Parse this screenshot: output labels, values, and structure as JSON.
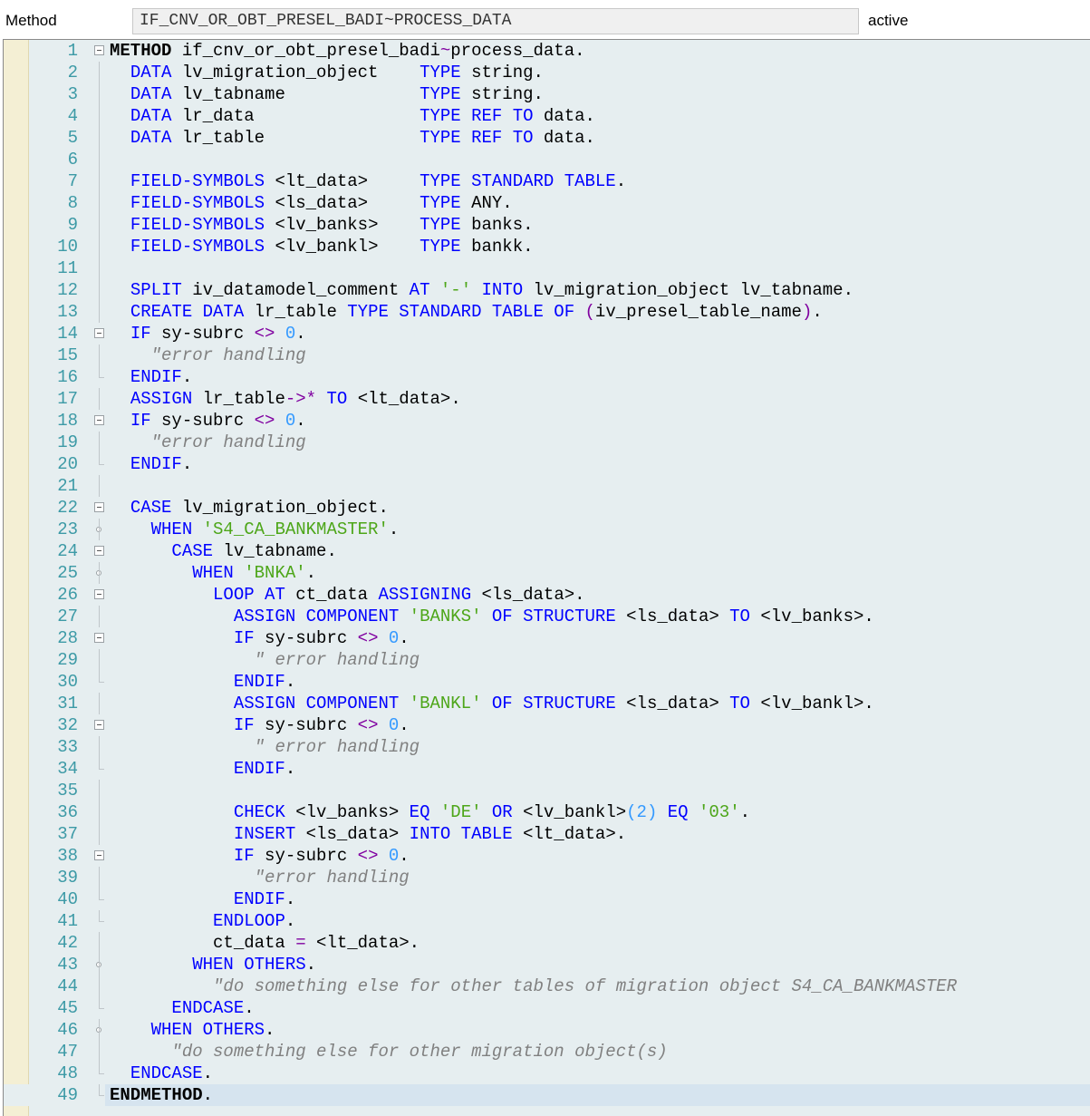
{
  "header": {
    "label": "Method",
    "method_name": "IF_CNV_OR_OBT_PRESEL_BADI~PROCESS_DATA",
    "status": "active"
  },
  "colors": {
    "keyword": "#0000ff",
    "string": "#4da619",
    "number": "#3399ff",
    "operator": "#8000a0",
    "comment": "#808080",
    "line_number": "#3d9aa6",
    "editor_bg": "#e6eef0",
    "current_line_bg": "#d6e4ef"
  },
  "editor": {
    "current_line": 49,
    "lines": [
      {
        "n": 1,
        "fold": "open",
        "tokens": [
          [
            "kwb",
            "METHOD"
          ],
          [
            "t",
            " if_cnv_or_obt_presel_badi"
          ],
          [
            "op",
            "~"
          ],
          [
            "t",
            "process_data"
          ],
          [
            "pn",
            "."
          ]
        ]
      },
      {
        "n": 2,
        "fold": "line",
        "tokens": [
          [
            "t",
            "  "
          ],
          [
            "kw",
            "DATA"
          ],
          [
            "t",
            " lv_migration_object    "
          ],
          [
            "kw",
            "TYPE"
          ],
          [
            "t",
            " string"
          ],
          [
            "pn",
            "."
          ]
        ]
      },
      {
        "n": 3,
        "fold": "line",
        "tokens": [
          [
            "t",
            "  "
          ],
          [
            "kw",
            "DATA"
          ],
          [
            "t",
            " lv_tabname             "
          ],
          [
            "kw",
            "TYPE"
          ],
          [
            "t",
            " string"
          ],
          [
            "pn",
            "."
          ]
        ]
      },
      {
        "n": 4,
        "fold": "line",
        "tokens": [
          [
            "t",
            "  "
          ],
          [
            "kw",
            "DATA"
          ],
          [
            "t",
            " lr_data                "
          ],
          [
            "kw",
            "TYPE REF TO"
          ],
          [
            "t",
            " data"
          ],
          [
            "pn",
            "."
          ]
        ]
      },
      {
        "n": 5,
        "fold": "line",
        "tokens": [
          [
            "t",
            "  "
          ],
          [
            "kw",
            "DATA"
          ],
          [
            "t",
            " lr_table               "
          ],
          [
            "kw",
            "TYPE REF TO"
          ],
          [
            "t",
            " data"
          ],
          [
            "pn",
            "."
          ]
        ]
      },
      {
        "n": 6,
        "fold": "line",
        "tokens": []
      },
      {
        "n": 7,
        "fold": "line",
        "tokens": [
          [
            "t",
            "  "
          ],
          [
            "kw",
            "FIELD-SYMBOLS"
          ],
          [
            "t",
            " <lt_data>     "
          ],
          [
            "kw",
            "TYPE STANDARD TABLE"
          ],
          [
            "pn",
            "."
          ]
        ]
      },
      {
        "n": 8,
        "fold": "line",
        "tokens": [
          [
            "t",
            "  "
          ],
          [
            "kw",
            "FIELD-SYMBOLS"
          ],
          [
            "t",
            " <ls_data>     "
          ],
          [
            "kw",
            "TYPE"
          ],
          [
            "t",
            " ANY"
          ],
          [
            "pn",
            "."
          ]
        ]
      },
      {
        "n": 9,
        "fold": "line",
        "tokens": [
          [
            "t",
            "  "
          ],
          [
            "kw",
            "FIELD-SYMBOLS"
          ],
          [
            "t",
            " <lv_banks>    "
          ],
          [
            "kw",
            "TYPE"
          ],
          [
            "t",
            " banks"
          ],
          [
            "pn",
            "."
          ]
        ]
      },
      {
        "n": 10,
        "fold": "line",
        "tokens": [
          [
            "t",
            "  "
          ],
          [
            "kw",
            "FIELD-SYMBOLS"
          ],
          [
            "t",
            " <lv_bankl>    "
          ],
          [
            "kw",
            "TYPE"
          ],
          [
            "t",
            " bankk"
          ],
          [
            "pn",
            "."
          ]
        ]
      },
      {
        "n": 11,
        "fold": "line",
        "tokens": []
      },
      {
        "n": 12,
        "fold": "line",
        "tokens": [
          [
            "t",
            "  "
          ],
          [
            "kw",
            "SPLIT"
          ],
          [
            "t",
            " iv_datamodel_comment "
          ],
          [
            "kw",
            "AT"
          ],
          [
            "t",
            " "
          ],
          [
            "str",
            "'-'"
          ],
          [
            "t",
            " "
          ],
          [
            "kw",
            "INTO"
          ],
          [
            "t",
            " lv_migration_object lv_tabname"
          ],
          [
            "pn",
            "."
          ]
        ]
      },
      {
        "n": 13,
        "fold": "line",
        "tokens": [
          [
            "t",
            "  "
          ],
          [
            "kw",
            "CREATE DATA"
          ],
          [
            "t",
            " lr_table "
          ],
          [
            "kw",
            "TYPE STANDARD TABLE OF"
          ],
          [
            "t",
            " "
          ],
          [
            "op",
            "("
          ],
          [
            "t",
            "iv_presel_table_name"
          ],
          [
            "op",
            ")"
          ],
          [
            "pn",
            "."
          ]
        ]
      },
      {
        "n": 14,
        "fold": "open",
        "tokens": [
          [
            "t",
            "  "
          ],
          [
            "kw",
            "IF"
          ],
          [
            "t",
            " sy-subrc "
          ],
          [
            "op",
            "<>"
          ],
          [
            "t",
            " "
          ],
          [
            "num",
            "0"
          ],
          [
            "pn",
            "."
          ]
        ]
      },
      {
        "n": 15,
        "fold": "line",
        "tokens": [
          [
            "t",
            "    "
          ],
          [
            "cm",
            "\"error handling"
          ]
        ]
      },
      {
        "n": 16,
        "fold": "end",
        "tokens": [
          [
            "t",
            "  "
          ],
          [
            "kw",
            "ENDIF"
          ],
          [
            "pn",
            "."
          ]
        ]
      },
      {
        "n": 17,
        "fold": "line",
        "tokens": [
          [
            "t",
            "  "
          ],
          [
            "kw",
            "ASSIGN"
          ],
          [
            "t",
            " lr_table"
          ],
          [
            "op",
            "->*"
          ],
          [
            "t",
            " "
          ],
          [
            "kw",
            "TO"
          ],
          [
            "t",
            " <lt_data>"
          ],
          [
            "pn",
            "."
          ]
        ]
      },
      {
        "n": 18,
        "fold": "open",
        "tokens": [
          [
            "t",
            "  "
          ],
          [
            "kw",
            "IF"
          ],
          [
            "t",
            " sy-subrc "
          ],
          [
            "op",
            "<>"
          ],
          [
            "t",
            " "
          ],
          [
            "num",
            "0"
          ],
          [
            "pn",
            "."
          ]
        ]
      },
      {
        "n": 19,
        "fold": "line",
        "tokens": [
          [
            "t",
            "    "
          ],
          [
            "cm",
            "\"error handling"
          ]
        ]
      },
      {
        "n": 20,
        "fold": "end",
        "tokens": [
          [
            "t",
            "  "
          ],
          [
            "kw",
            "ENDIF"
          ],
          [
            "pn",
            "."
          ]
        ]
      },
      {
        "n": 21,
        "fold": "line",
        "tokens": []
      },
      {
        "n": 22,
        "fold": "open",
        "tokens": [
          [
            "t",
            "  "
          ],
          [
            "kw",
            "CASE"
          ],
          [
            "t",
            " lv_migration_object"
          ],
          [
            "pn",
            "."
          ]
        ]
      },
      {
        "n": 23,
        "fold": "mid",
        "tokens": [
          [
            "t",
            "    "
          ],
          [
            "kw",
            "WHEN"
          ],
          [
            "t",
            " "
          ],
          [
            "str",
            "'S4_CA_BANKMASTER'"
          ],
          [
            "pn",
            "."
          ]
        ]
      },
      {
        "n": 24,
        "fold": "open",
        "tokens": [
          [
            "t",
            "      "
          ],
          [
            "kw",
            "CASE"
          ],
          [
            "t",
            " lv_tabname"
          ],
          [
            "pn",
            "."
          ]
        ]
      },
      {
        "n": 25,
        "fold": "mid",
        "tokens": [
          [
            "t",
            "        "
          ],
          [
            "kw",
            "WHEN"
          ],
          [
            "t",
            " "
          ],
          [
            "str",
            "'BNKA'"
          ],
          [
            "pn",
            "."
          ]
        ]
      },
      {
        "n": 26,
        "fold": "open",
        "tokens": [
          [
            "t",
            "          "
          ],
          [
            "kw",
            "LOOP AT"
          ],
          [
            "t",
            " ct_data "
          ],
          [
            "kw",
            "ASSIGNING"
          ],
          [
            "t",
            " <ls_data>"
          ],
          [
            "pn",
            "."
          ]
        ]
      },
      {
        "n": 27,
        "fold": "line",
        "tokens": [
          [
            "t",
            "            "
          ],
          [
            "kw",
            "ASSIGN COMPONENT"
          ],
          [
            "t",
            " "
          ],
          [
            "str",
            "'BANKS'"
          ],
          [
            "t",
            " "
          ],
          [
            "kw",
            "OF STRUCTURE"
          ],
          [
            "t",
            " <ls_data> "
          ],
          [
            "kw",
            "TO"
          ],
          [
            "t",
            " <lv_banks>"
          ],
          [
            "pn",
            "."
          ]
        ]
      },
      {
        "n": 28,
        "fold": "open",
        "tokens": [
          [
            "t",
            "            "
          ],
          [
            "kw",
            "IF"
          ],
          [
            "t",
            " sy-subrc "
          ],
          [
            "op",
            "<>"
          ],
          [
            "t",
            " "
          ],
          [
            "num",
            "0"
          ],
          [
            "pn",
            "."
          ]
        ]
      },
      {
        "n": 29,
        "fold": "line",
        "tokens": [
          [
            "t",
            "              "
          ],
          [
            "cm",
            "\" error handling"
          ]
        ]
      },
      {
        "n": 30,
        "fold": "end",
        "tokens": [
          [
            "t",
            "            "
          ],
          [
            "kw",
            "ENDIF"
          ],
          [
            "pn",
            "."
          ]
        ]
      },
      {
        "n": 31,
        "fold": "line",
        "tokens": [
          [
            "t",
            "            "
          ],
          [
            "kw",
            "ASSIGN COMPONENT"
          ],
          [
            "t",
            " "
          ],
          [
            "str",
            "'BANKL'"
          ],
          [
            "t",
            " "
          ],
          [
            "kw",
            "OF STRUCTURE"
          ],
          [
            "t",
            " <ls_data> "
          ],
          [
            "kw",
            "TO"
          ],
          [
            "t",
            " <lv_bankl>"
          ],
          [
            "pn",
            "."
          ]
        ]
      },
      {
        "n": 32,
        "fold": "open",
        "tokens": [
          [
            "t",
            "            "
          ],
          [
            "kw",
            "IF"
          ],
          [
            "t",
            " sy-subrc "
          ],
          [
            "op",
            "<>"
          ],
          [
            "t",
            " "
          ],
          [
            "num",
            "0"
          ],
          [
            "pn",
            "."
          ]
        ]
      },
      {
        "n": 33,
        "fold": "line",
        "tokens": [
          [
            "t",
            "              "
          ],
          [
            "cm",
            "\" error handling"
          ]
        ]
      },
      {
        "n": 34,
        "fold": "end",
        "tokens": [
          [
            "t",
            "            "
          ],
          [
            "kw",
            "ENDIF"
          ],
          [
            "pn",
            "."
          ]
        ]
      },
      {
        "n": 35,
        "fold": "line",
        "tokens": []
      },
      {
        "n": 36,
        "fold": "line",
        "tokens": [
          [
            "t",
            "            "
          ],
          [
            "kw",
            "CHECK"
          ],
          [
            "t",
            " <lv_banks> "
          ],
          [
            "kw",
            "EQ"
          ],
          [
            "t",
            " "
          ],
          [
            "str",
            "'DE'"
          ],
          [
            "t",
            " "
          ],
          [
            "kw",
            "OR"
          ],
          [
            "t",
            " <lv_bankl>"
          ],
          [
            "num",
            "(2)"
          ],
          [
            "t",
            " "
          ],
          [
            "kw",
            "EQ"
          ],
          [
            "t",
            " "
          ],
          [
            "str",
            "'03'"
          ],
          [
            "pn",
            "."
          ]
        ]
      },
      {
        "n": 37,
        "fold": "line",
        "tokens": [
          [
            "t",
            "            "
          ],
          [
            "kw",
            "INSERT"
          ],
          [
            "t",
            " <ls_data> "
          ],
          [
            "kw",
            "INTO TABLE"
          ],
          [
            "t",
            " <lt_data>"
          ],
          [
            "pn",
            "."
          ]
        ]
      },
      {
        "n": 38,
        "fold": "open",
        "tokens": [
          [
            "t",
            "            "
          ],
          [
            "kw",
            "IF"
          ],
          [
            "t",
            " sy-subrc "
          ],
          [
            "op",
            "<>"
          ],
          [
            "t",
            " "
          ],
          [
            "num",
            "0"
          ],
          [
            "pn",
            "."
          ]
        ]
      },
      {
        "n": 39,
        "fold": "line",
        "tokens": [
          [
            "t",
            "              "
          ],
          [
            "cm",
            "\"error handling"
          ]
        ]
      },
      {
        "n": 40,
        "fold": "end",
        "tokens": [
          [
            "t",
            "            "
          ],
          [
            "kw",
            "ENDIF"
          ],
          [
            "pn",
            "."
          ]
        ]
      },
      {
        "n": 41,
        "fold": "end",
        "tokens": [
          [
            "t",
            "          "
          ],
          [
            "kw",
            "ENDLOOP"
          ],
          [
            "pn",
            "."
          ]
        ]
      },
      {
        "n": 42,
        "fold": "line",
        "tokens": [
          [
            "t",
            "          ct_data "
          ],
          [
            "op",
            "="
          ],
          [
            "t",
            " <lt_data>"
          ],
          [
            "pn",
            "."
          ]
        ]
      },
      {
        "n": 43,
        "fold": "mid",
        "tokens": [
          [
            "t",
            "        "
          ],
          [
            "kw",
            "WHEN OTHERS"
          ],
          [
            "pn",
            "."
          ]
        ]
      },
      {
        "n": 44,
        "fold": "line",
        "tokens": [
          [
            "t",
            "          "
          ],
          [
            "cm",
            "\"do something else for other tables of migration object S4_CA_BANKMASTER"
          ]
        ]
      },
      {
        "n": 45,
        "fold": "end",
        "tokens": [
          [
            "t",
            "      "
          ],
          [
            "kw",
            "ENDCASE"
          ],
          [
            "pn",
            "."
          ]
        ]
      },
      {
        "n": 46,
        "fold": "mid",
        "tokens": [
          [
            "t",
            "    "
          ],
          [
            "kw",
            "WHEN OTHERS"
          ],
          [
            "pn",
            "."
          ]
        ]
      },
      {
        "n": 47,
        "fold": "line",
        "tokens": [
          [
            "t",
            "      "
          ],
          [
            "cm",
            "\"do something else for other migration object(s)"
          ]
        ]
      },
      {
        "n": 48,
        "fold": "end",
        "tokens": [
          [
            "t",
            "  "
          ],
          [
            "kw",
            "ENDCASE"
          ],
          [
            "pn",
            "."
          ]
        ]
      },
      {
        "n": 49,
        "fold": "end",
        "tokens": [
          [
            "kwb",
            "ENDMETHOD"
          ],
          [
            "pn",
            "."
          ]
        ]
      }
    ]
  }
}
